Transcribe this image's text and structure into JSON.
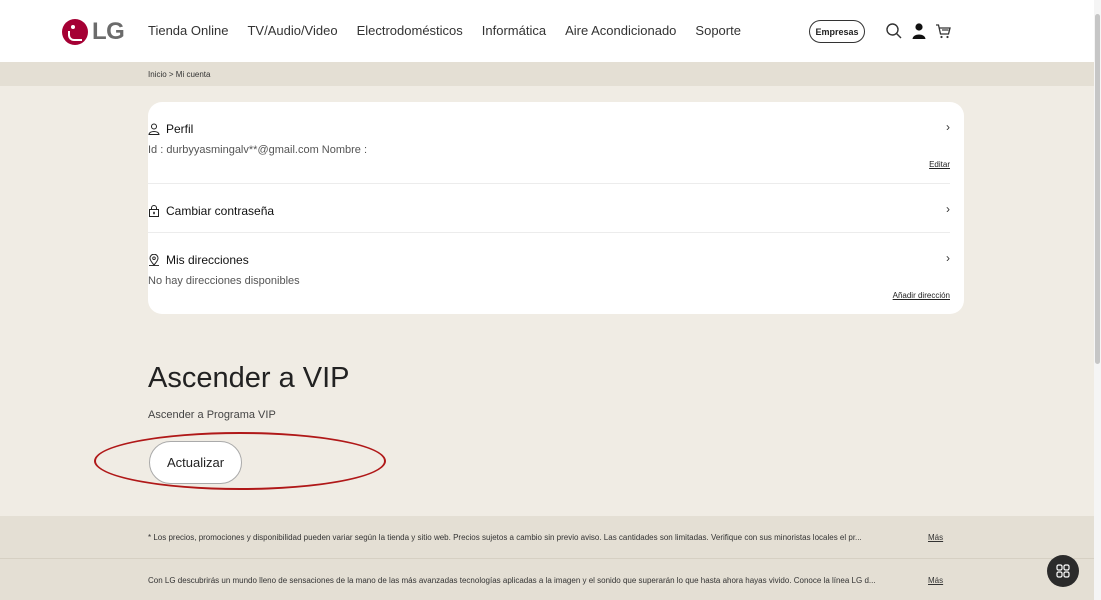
{
  "header": {
    "logo_text": "LG",
    "nav": [
      "Tienda Online",
      "TV/Audio/Video",
      "Electrodomésticos",
      "Informática",
      "Aire Acondicionado",
      "Soporte"
    ],
    "empresas_label": "Empresas",
    "icons": [
      "search-icon",
      "user-icon",
      "cart-icon"
    ]
  },
  "breadcrumb": "Inicio > Mi cuenta",
  "account": {
    "profile": {
      "title": "Perfil",
      "details": "Id : durbyyasmingalv**@gmail.com    Nombre :",
      "link": "Editar"
    },
    "password": {
      "title": "Cambiar contraseña"
    },
    "addresses": {
      "title": "Mis direcciones",
      "details": "No hay direcciones disponibles",
      "link": "Añadir dirección"
    },
    "chevron": "›"
  },
  "vip": {
    "title": "Ascender a VIP",
    "subtitle": "Ascender a Programa VIP",
    "button": "Actualizar"
  },
  "disclaimers": [
    {
      "text": "* Los precios, promociones y disponibilidad pueden variar según la tienda y sitio web. Precios sujetos a cambio sin previo aviso. Las cantidades son limitadas. Verifique con sus minoristas locales el pr...",
      "more": "Más"
    },
    {
      "text": "Con LG descubrirás un mundo lleno de sensaciones de la mano de las más avanzadas tecnologías aplicadas a la imagen y el sonido que superarán lo que hasta ahora hayas vivido. Conoce la línea LG d...",
      "more": "Más"
    }
  ],
  "colors": {
    "brand": "#a50034",
    "background": "#f0ece4",
    "band": "#e4dfd4",
    "highlight": "#b01818"
  }
}
